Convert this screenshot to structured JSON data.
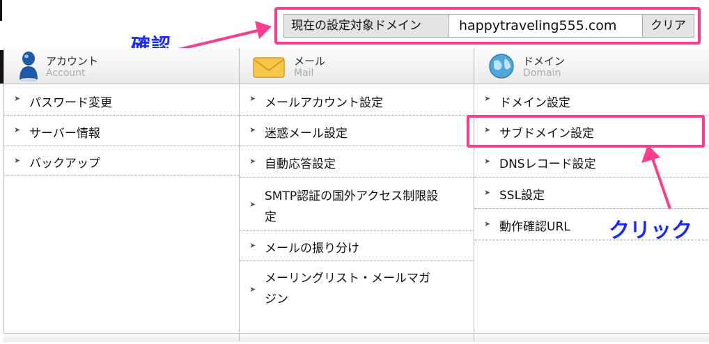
{
  "domain_bar": {
    "label": "現在の設定対象ドメイン",
    "value": "happytraveling555.com",
    "clear": "クリア"
  },
  "annotations": {
    "confirm": "確認",
    "click": "クリック"
  },
  "columns": [
    {
      "title_jp": "アカウント",
      "title_en": "Account",
      "icon": "user-icon",
      "items": [
        "パスワード変更",
        "サーバー情報",
        "バックアップ"
      ]
    },
    {
      "title_jp": "メール",
      "title_en": "Mail",
      "icon": "envelope-icon",
      "items": [
        "メールアカウント設定",
        "迷惑メール設定",
        "自動応答設定",
        "SMTP認証の国外アクセス制限設",
        "定",
        "メールの振り分け",
        "メーリングリスト・メールマガ",
        "ジン"
      ]
    },
    {
      "title_jp": "ドメイン",
      "title_en": "Domain",
      "icon": "globe-icon",
      "items": [
        "ドメイン設定",
        "サブドメイン設定",
        "DNSレコード設定",
        "SSL設定",
        "動作確認URL"
      ]
    }
  ],
  "colors": {
    "accent": "#ff3d8e",
    "annotation": "#1a2bff"
  }
}
